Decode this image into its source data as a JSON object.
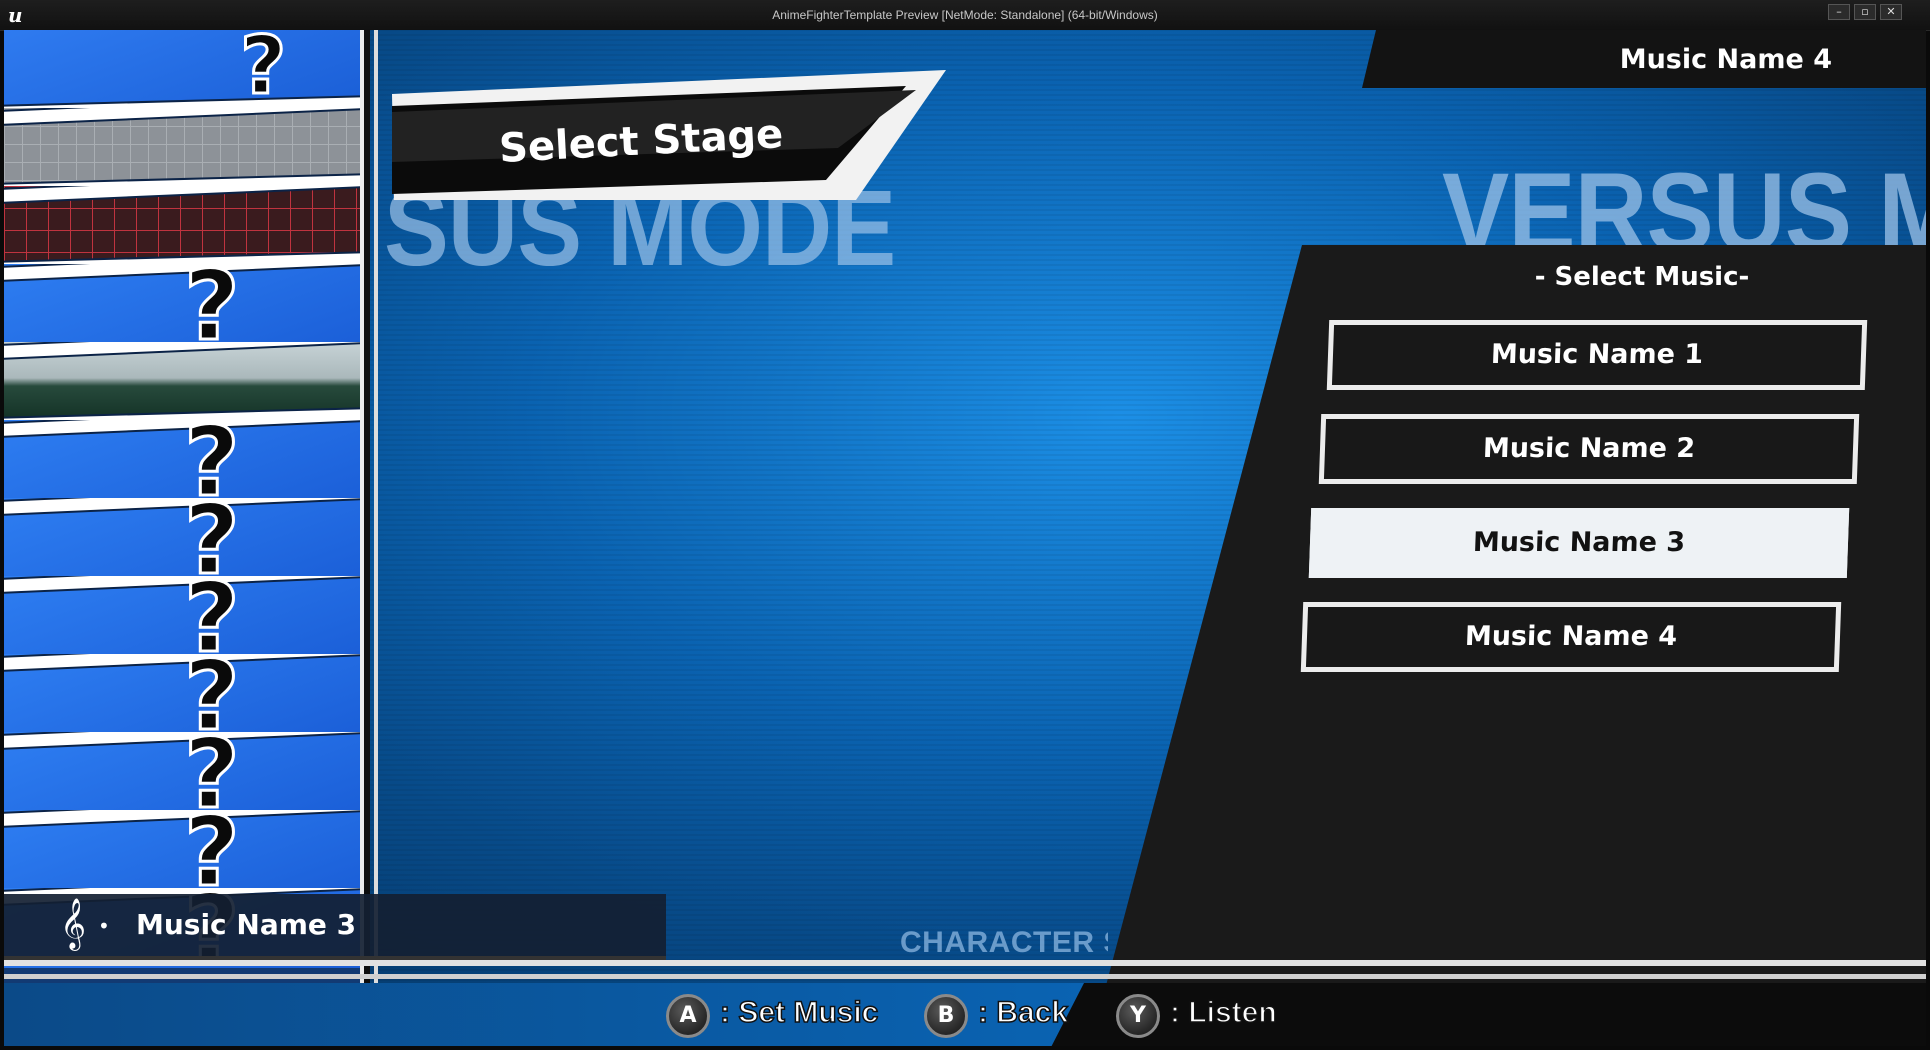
{
  "window": {
    "title": "AnimeFighterTemplate Preview [NetMode: Standalone]  (64-bit/Windows)",
    "logo": "u",
    "controls": {
      "minimize": "–",
      "maximize": "▫",
      "close": "✕"
    }
  },
  "stage_list": {
    "random_icon": "?",
    "locked_icon": "?"
  },
  "header": {
    "banner_title": "Select Stage",
    "background_text_left": "SUS MODE",
    "background_text_right": "VERSUS MO",
    "current_music": "Music Name 4"
  },
  "music_panel": {
    "heading": "- Select Music-",
    "items": [
      {
        "label": "Music Name 1",
        "selected": false
      },
      {
        "label": "Music Name 2",
        "selected": false
      },
      {
        "label": "Music Name 3",
        "selected": true
      },
      {
        "label": "Music Name 4",
        "selected": false
      }
    ]
  },
  "now_playing": {
    "icon": "𝄞",
    "dot": "•",
    "label": "Music Name 3"
  },
  "footer": {
    "background_text": "CHARACTER S",
    "hints": [
      {
        "button": "A",
        "label": ": Set Music"
      },
      {
        "button": "B",
        "label": ": Back"
      },
      {
        "button": "Y",
        "label": ": Listen"
      }
    ]
  },
  "colors": {
    "accent_blue": "#0a63b2",
    "panel_dark": "#181818",
    "selected_bg": "#eef2f5"
  }
}
